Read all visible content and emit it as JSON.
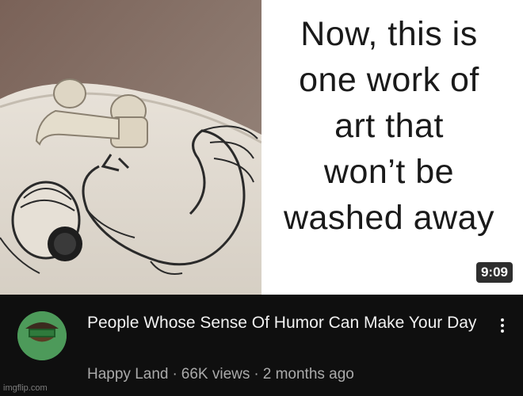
{
  "video": {
    "duration": "9:09",
    "thumbnail_caption": [
      "Now, this is",
      "one work of",
      "art that",
      "won’t be",
      "washed away"
    ],
    "title": "People Whose Sense Of Humor Can Make Your Day"
  },
  "channel": {
    "name": "Happy Land",
    "views": "66K views",
    "age": "2 months ago",
    "avatar_icon": "channel-logo-icon"
  },
  "menu": {
    "icon": "more-vert-icon"
  },
  "watermark": "imgflip.com",
  "colors": {
    "background": "#0f0f0f",
    "avatar": "#4d9a5a",
    "title": "#f1f1f1",
    "meta": "#aaaaaa"
  }
}
